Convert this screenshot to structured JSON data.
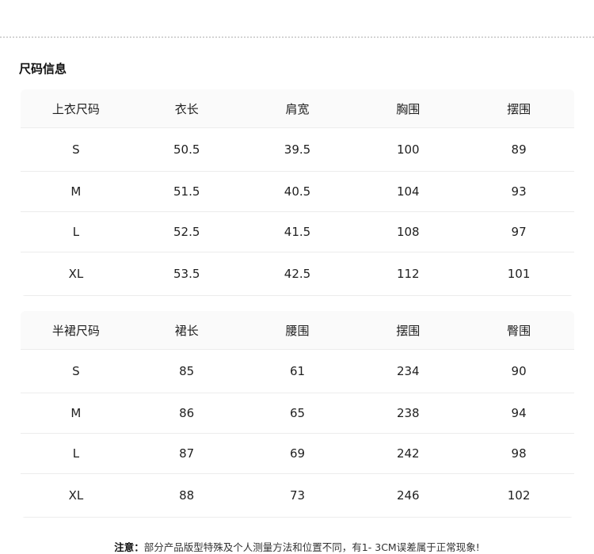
{
  "section_title": "尺码信息",
  "top_table": {
    "headers": [
      "上衣尺码",
      "衣长",
      "肩宽",
      "胸围",
      "摆围"
    ],
    "rows": [
      [
        "S",
        "50.5",
        "39.5",
        "100",
        "89"
      ],
      [
        "M",
        "51.5",
        "40.5",
        "104",
        "93"
      ],
      [
        "L",
        "52.5",
        "41.5",
        "108",
        "97"
      ],
      [
        "XL",
        "53.5",
        "42.5",
        "112",
        "101"
      ]
    ]
  },
  "skirt_table": {
    "headers": [
      "半裙尺码",
      "裙长",
      "腰围",
      "摆围",
      "臀围"
    ],
    "rows": [
      [
        "S",
        "85",
        "61",
        "234",
        "90"
      ],
      [
        "M",
        "86",
        "65",
        "238",
        "94"
      ],
      [
        "L",
        "87",
        "69",
        "242",
        "98"
      ],
      [
        "XL",
        "88",
        "73",
        "246",
        "102"
      ]
    ]
  },
  "note": {
    "label": "注意：",
    "text": "部分产品版型特殊及个人测量方法和位置不同，有1- 3CM误差属于正常现象!"
  }
}
